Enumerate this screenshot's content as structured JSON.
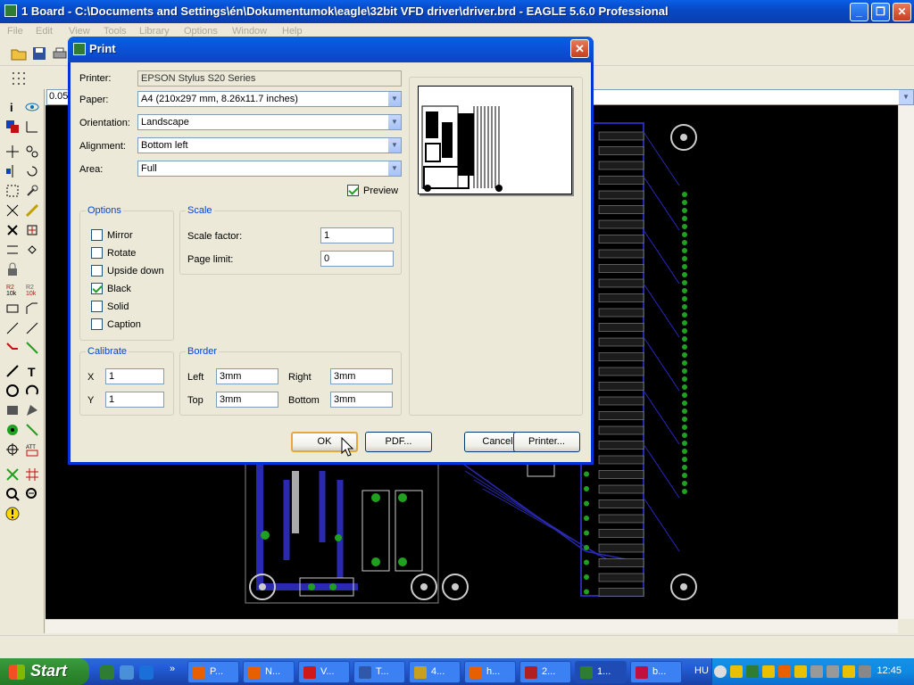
{
  "window": {
    "title": "1 Board - C:\\Documents and Settings\\én\\Dokumentumok\\eagle\\32bit VFD driver\\driver.brd - EAGLE 5.6.0 Professional",
    "minimize": "_",
    "restore": "❐",
    "close": "✕"
  },
  "menu": [
    "File",
    "Edit",
    "View",
    "Tools",
    "Library",
    "Options",
    "Window",
    "Help"
  ],
  "coordbar": {
    "value": "0.05"
  },
  "dialog": {
    "title": "Print",
    "close": "✕",
    "printer_label": "Printer:",
    "printer_value": "EPSON Stylus S20 Series",
    "paper_label": "Paper:",
    "paper_value": "A4 (210x297 mm, 8.26x11.7 inches)",
    "orientation_label": "Orientation:",
    "orientation_value": "Landscape",
    "alignment_label": "Alignment:",
    "alignment_value": "Bottom left",
    "area_label": "Area:",
    "area_value": "Full",
    "preview_label": "Preview",
    "preview_checked": true,
    "options": {
      "title": "Options",
      "items": [
        {
          "label": "Mirror",
          "checked": false
        },
        {
          "label": "Rotate",
          "checked": false
        },
        {
          "label": "Upside down",
          "checked": false
        },
        {
          "label": "Black",
          "checked": true
        },
        {
          "label": "Solid",
          "checked": false
        },
        {
          "label": "Caption",
          "checked": false
        }
      ]
    },
    "scale": {
      "title": "Scale",
      "factor_label": "Scale factor:",
      "factor_value": "1",
      "limit_label": "Page limit:",
      "limit_value": "0"
    },
    "calibrate": {
      "title": "Calibrate",
      "x_label": "X",
      "x_value": "1",
      "y_label": "Y",
      "y_value": "1"
    },
    "border": {
      "title": "Border",
      "left_label": "Left",
      "left_value": "3mm",
      "right_label": "Right",
      "right_value": "3mm",
      "top_label": "Top",
      "top_value": "3mm",
      "bottom_label": "Bottom",
      "bottom_value": "3mm"
    },
    "buttons": {
      "ok": "OK",
      "pdf": "PDF...",
      "cancel": "Cancel",
      "printer": "Printer..."
    }
  },
  "taskbar": {
    "start": "Start",
    "tasks": [
      {
        "label": "P...",
        "color": "#e66000"
      },
      {
        "label": "N...",
        "color": "#e66000"
      },
      {
        "label": "V...",
        "color": "#d01818"
      },
      {
        "label": "T...",
        "color": "#3058a8"
      },
      {
        "label": "4...",
        "color": "#c8a020"
      },
      {
        "label": "h...",
        "color": "#e66000"
      },
      {
        "label": "2...",
        "color": "#b02020"
      },
      {
        "label": "1...",
        "color": "#2e7d32"
      },
      {
        "label": "b...",
        "color": "#c01040"
      }
    ],
    "lang": "HU",
    "clock": "12:45"
  }
}
